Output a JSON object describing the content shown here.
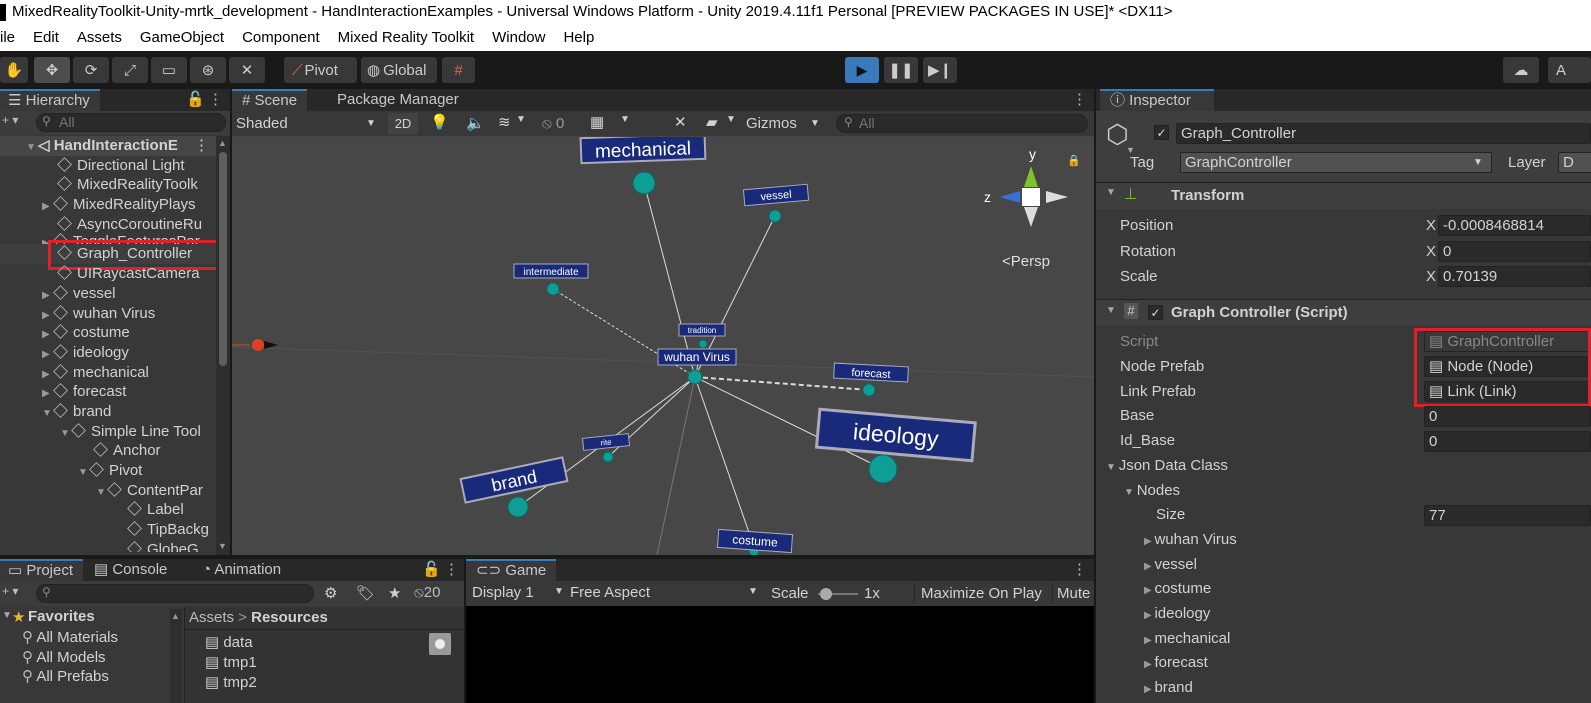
{
  "window": {
    "title": "MixedRealityToolkit-Unity-mrtk_development - HandInteractionExamples - Universal Windows Platform - Unity 2019.4.11f1 Personal [PREVIEW PACKAGES IN USE]* <DX11>"
  },
  "menu": [
    "ile",
    "Edit",
    "Assets",
    "GameObject",
    "Component",
    "Mixed Reality Toolkit",
    "Window",
    "Help"
  ],
  "toolbar": {
    "pivot": "Pivot",
    "global": "Global",
    "account": "A"
  },
  "hierarchy": {
    "tab": "Hierarchy",
    "search_placeholder": "All",
    "scene": "HandInteractionE",
    "items": [
      "Directional Light",
      "MixedRealityToolk",
      "MixedRealityPlays",
      "AsyncCoroutineRu",
      "ToggleFeaturesPar",
      "Graph_Controller",
      "UIRaycastCamera",
      "vessel",
      "wuhan Virus",
      "costume",
      "ideology",
      "mechanical",
      "forecast",
      "brand",
      "Simple Line Tool",
      "Anchor",
      "Pivot",
      "ContentPar",
      "Label",
      "TipBackg",
      "GlobeG"
    ]
  },
  "scene": {
    "tab_scene": "Scene",
    "tab_pm": "Package Manager",
    "shading": "Shaded",
    "mode2d": "2D",
    "hidden_count": "0",
    "gizmos": "Gizmos",
    "search_placeholder": "All",
    "persp": "Persp",
    "axis_y": "y",
    "axis_z": "z",
    "labels": {
      "mechanical": "mechanical",
      "vessel": "vessel",
      "intermediate": "intermediate",
      "tradition": "tradition",
      "wuhan": "wuhan Virus",
      "forecast": "forecast",
      "ideology": "ideology",
      "rite": "rite",
      "brand": "brand",
      "costume": "costume"
    }
  },
  "inspector": {
    "tab": "Inspector",
    "object_name": "Graph_Controller",
    "tag_label": "Tag",
    "tag_value": "GraphController",
    "layer_label": "Layer",
    "layer_value": "D",
    "transform": {
      "title": "Transform",
      "position_label": "Position",
      "position_x": "-0.0008468814",
      "rotation_label": "Rotation",
      "rotation_x": "0",
      "scale_label": "Scale",
      "scale_x": "0.70139",
      "x": "X"
    },
    "script": {
      "title": "Graph Controller (Script)",
      "script_label": "Script",
      "script_value": "GraphController",
      "node_prefab_label": "Node Prefab",
      "node_prefab_value": "Node (Node)",
      "link_prefab_label": "Link Prefab",
      "link_prefab_value": "Link (Link)",
      "base_label": "Base",
      "base_value": "0",
      "id_base_label": "Id_Base",
      "id_base_value": "0",
      "json_label": "Json Data Class",
      "nodes_label": "Nodes",
      "size_label": "Size",
      "size_value": "77",
      "nodes": [
        "wuhan Virus",
        "vessel",
        "costume",
        "ideology",
        "mechanical",
        "forecast",
        "brand"
      ]
    }
  },
  "project": {
    "tab_project": "Project",
    "tab_console": "Console",
    "tab_animation": "Animation",
    "hidden_count": "20",
    "favorites": "Favorites",
    "fav_items": [
      "All Materials",
      "All Models",
      "All Prefabs"
    ],
    "crumb_assets": "Assets",
    "crumb_resources": "Resources",
    "files": [
      "data",
      "tmp1",
      "tmp2"
    ]
  },
  "game": {
    "tab": "Game",
    "display": "Display 1",
    "aspect": "Free Aspect",
    "scale_label": "Scale",
    "scale_value": "1x",
    "maximize": "Maximize On Play",
    "mute": "Mute"
  }
}
